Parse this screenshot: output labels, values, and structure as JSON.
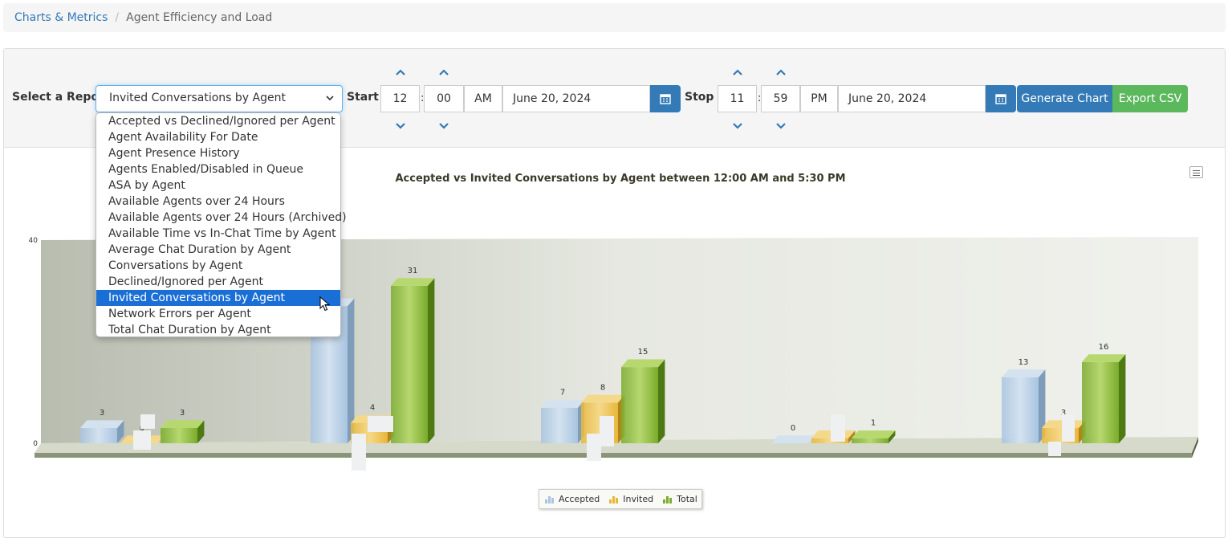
{
  "breadcrumb": {
    "root": "Charts & Metrics",
    "separator": "/",
    "current": "Agent Efficiency and Load"
  },
  "toolbar": {
    "report_label": "Select a Report",
    "report_selected": "Invited Conversations by Agent",
    "start_label": "Start",
    "start_hour": "12",
    "start_minute": "00",
    "start_ampm": "AM",
    "start_date": "June 20, 2024",
    "stop_label": "Stop",
    "stop_hour": "11",
    "stop_minute": "59",
    "stop_ampm": "PM",
    "stop_date": "June 20, 2024",
    "colon": ":",
    "generate_label": "Generate Chart",
    "export_label": "Export CSV"
  },
  "dropdown": {
    "options": [
      "Accepted vs Declined/Ignored per Agent",
      "Agent Availability For Date",
      "Agent Presence History",
      "Agents Enabled/Disabled in Queue",
      "ASA by Agent",
      "Available Agents over 24 Hours",
      "Available Agents over 24 Hours (Archived)",
      "Available Time vs In-Chat Time by Agent",
      "Average Chat Duration by Agent",
      "Conversations by Agent",
      "Declined/Ignored per Agent",
      "Invited Conversations by Agent",
      "Network Errors per Agent",
      "Total Chat Duration by Agent"
    ],
    "selected_index": 11
  },
  "colors": {
    "accepted": "#a8c4e0",
    "invited": "#e8b73a",
    "total": "#7aab2c",
    "primary": "#337ab7",
    "success": "#5cb85c"
  },
  "chart_data": {
    "type": "bar",
    "title": "Accepted vs Invited Conversations by Agent between 12:00 AM and 5:30 PM",
    "categories": [
      "",
      "",
      "",
      "",
      ""
    ],
    "series": [
      {
        "name": "Accepted",
        "values": [
          3,
          27,
          7,
          0,
          13
        ]
      },
      {
        "name": "Invited",
        "values": [
          0,
          4,
          8,
          1,
          3
        ]
      },
      {
        "name": "Total",
        "values": [
          3,
          31,
          15,
          1,
          16
        ]
      }
    ],
    "ylim": [
      0,
      40
    ],
    "yticks": [
      "0",
      "40"
    ],
    "legend_position": "bottom",
    "three_d": true,
    "grid": false
  }
}
